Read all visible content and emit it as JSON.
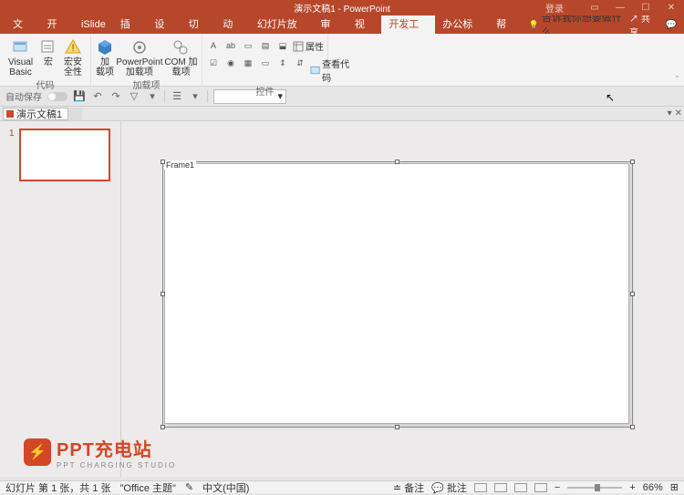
{
  "titlebar": {
    "title": "演示文稿1 - PowerPoint",
    "signin": "登录"
  },
  "tabs": {
    "file": "文件",
    "home": "开始",
    "islide": "iSlide",
    "insert": "插入",
    "design": "设计",
    "transitions": "切换",
    "animations": "动画",
    "slideshow": "幻灯片放映",
    "review": "审阅",
    "view": "视图",
    "developer": "开发工具",
    "officetab": "办公标签",
    "help": "帮助",
    "tellme": "告诉我你想要做什么",
    "share": "共享"
  },
  "ribbon": {
    "code": {
      "vb": "Visual Basic",
      "macros": "宏",
      "macrosecurity": "宏安全性",
      "label": "代码"
    },
    "addins": {
      "addins": "加\n载项",
      "ppaddins": "PowerPoint\n加载项",
      "com": "COM 加载项",
      "label": "加载项"
    },
    "controls": {
      "viewcode": "查看代码",
      "label": "控件"
    }
  },
  "qat": {
    "autosave": "自动保存"
  },
  "doctab": {
    "name": "演示文稿1"
  },
  "slidepanel": {
    "num": "1"
  },
  "slide": {
    "framelabel": "Frame1"
  },
  "watermark": {
    "t1": "PPT充电站",
    "t2": "PPT CHARGING STUDIO"
  },
  "status": {
    "slideinfo": "幻灯片 第 1 张，共 1 张",
    "theme": "\"Office 主题\"",
    "lang": "中文(中国)",
    "notes": "备注",
    "comments": "批注",
    "zoom": "66%"
  }
}
